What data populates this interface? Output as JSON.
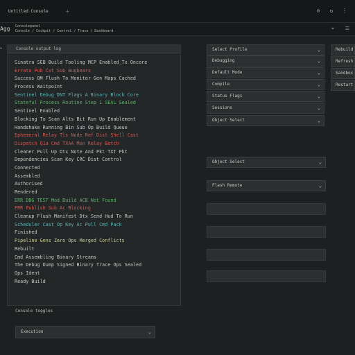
{
  "topbar": {
    "active_tab_label": "Untitled Console",
    "new_tab_glyph": "+",
    "icons": [
      "shield-icon",
      "cloud-sync-icon",
      "settings-icon"
    ]
  },
  "addressbar": {
    "back_label": "Agg",
    "path_line1": "Consolepanel",
    "path_line2": "Console / Cockpit / Control / Trace / Dashboard"
  },
  "console": {
    "header": "Console output log",
    "lines": [
      {
        "text": "Sinatra SEB Build Tooling MCP Enabled_Tx Oncore",
        "color": "w"
      },
      {
        "text": "Errata Pub Cxt Sub Bugbears",
        "color": "r"
      },
      {
        "text": "Success QM Flush To Monitor Gen Maps Cached",
        "color": "w"
      },
      {
        "text": "Process Waitpoint",
        "color": "w"
      },
      {
        "text": "Sentinel Debug DNT Flags A Binary Block Core",
        "color": "c"
      },
      {
        "text": "Stateful Process Routine Step 1 SEAL Sealed",
        "color": "g"
      },
      {
        "text": "Sentinel Enabled",
        "color": "w"
      },
      {
        "text": "Blocking To Scan Alts Bit Run Up Enablement",
        "color": "w"
      },
      {
        "text": "Handshake Running Bin Sub Op Build Queue",
        "color": "w"
      },
      {
        "text": "Ephemeral Relay Tls Node Ref Dist Shell Cast",
        "color": "r"
      },
      {
        "text": "Dispatch Q1a Cmd TXAA Mon Relay Batch",
        "color": "r"
      },
      {
        "text": "Cleaner Pull Up Dtx Note And Pkt TXT Pkt",
        "color": "w"
      },
      {
        "text": "Dependencies Scan Key CRC Dist Control",
        "color": "w"
      },
      {
        "text": "Connected",
        "color": "w"
      },
      {
        "text": "Assembled",
        "color": "w"
      },
      {
        "text": "Authorised",
        "color": "w"
      },
      {
        "text": "Rendered",
        "color": "w"
      },
      {
        "text": "ERR DBG TEST Mod Build ACB Not Found",
        "color": "g"
      },
      {
        "text": "ERR Publish Sub Ac Blocking",
        "color": "r"
      },
      {
        "text": "Cleanup Flush Manifest Dtx Send Hud To Run",
        "color": "w"
      },
      {
        "text": "Scheduler Cast Op Key Ac Pull Cmd Pack",
        "color": "c"
      },
      {
        "text": "Finished",
        "color": "w"
      },
      {
        "text": "Pipeline Gens Zero Ops Merged Conflicts",
        "color": "y"
      },
      {
        "text": "Rebuilt",
        "color": "w"
      },
      {
        "text": "Cmd Assembling Binary Streams",
        "color": "w"
      },
      {
        "text": "The Debug Dump Signed Binary Trace Ops Sealed",
        "color": "w"
      },
      {
        "text": "Ops Ident",
        "color": "w"
      },
      {
        "text": "Ready Build",
        "color": "w"
      }
    ]
  },
  "below_console_label": "Console toggles",
  "bottom_select": {
    "value": "Execution"
  },
  "right_panel": {
    "selects": [
      "Select Profile",
      "Debugging",
      "Default Mode",
      "Compile",
      "Status Flags",
      "Sessions",
      "Object Select"
    ],
    "wide_selects": [
      "Object Select",
      "Flash Remote"
    ],
    "blank_fields_count_note": ""
  },
  "side_buttons": [
    "Rebuild",
    "Refresh",
    "Sandbox",
    "Restart"
  ],
  "colors": {
    "background": "#1d2021",
    "panel": "#242728",
    "field": "#2b2f30",
    "red": "#d05a54",
    "green": "#5fb26b",
    "cyan": "#5fb5b8"
  }
}
